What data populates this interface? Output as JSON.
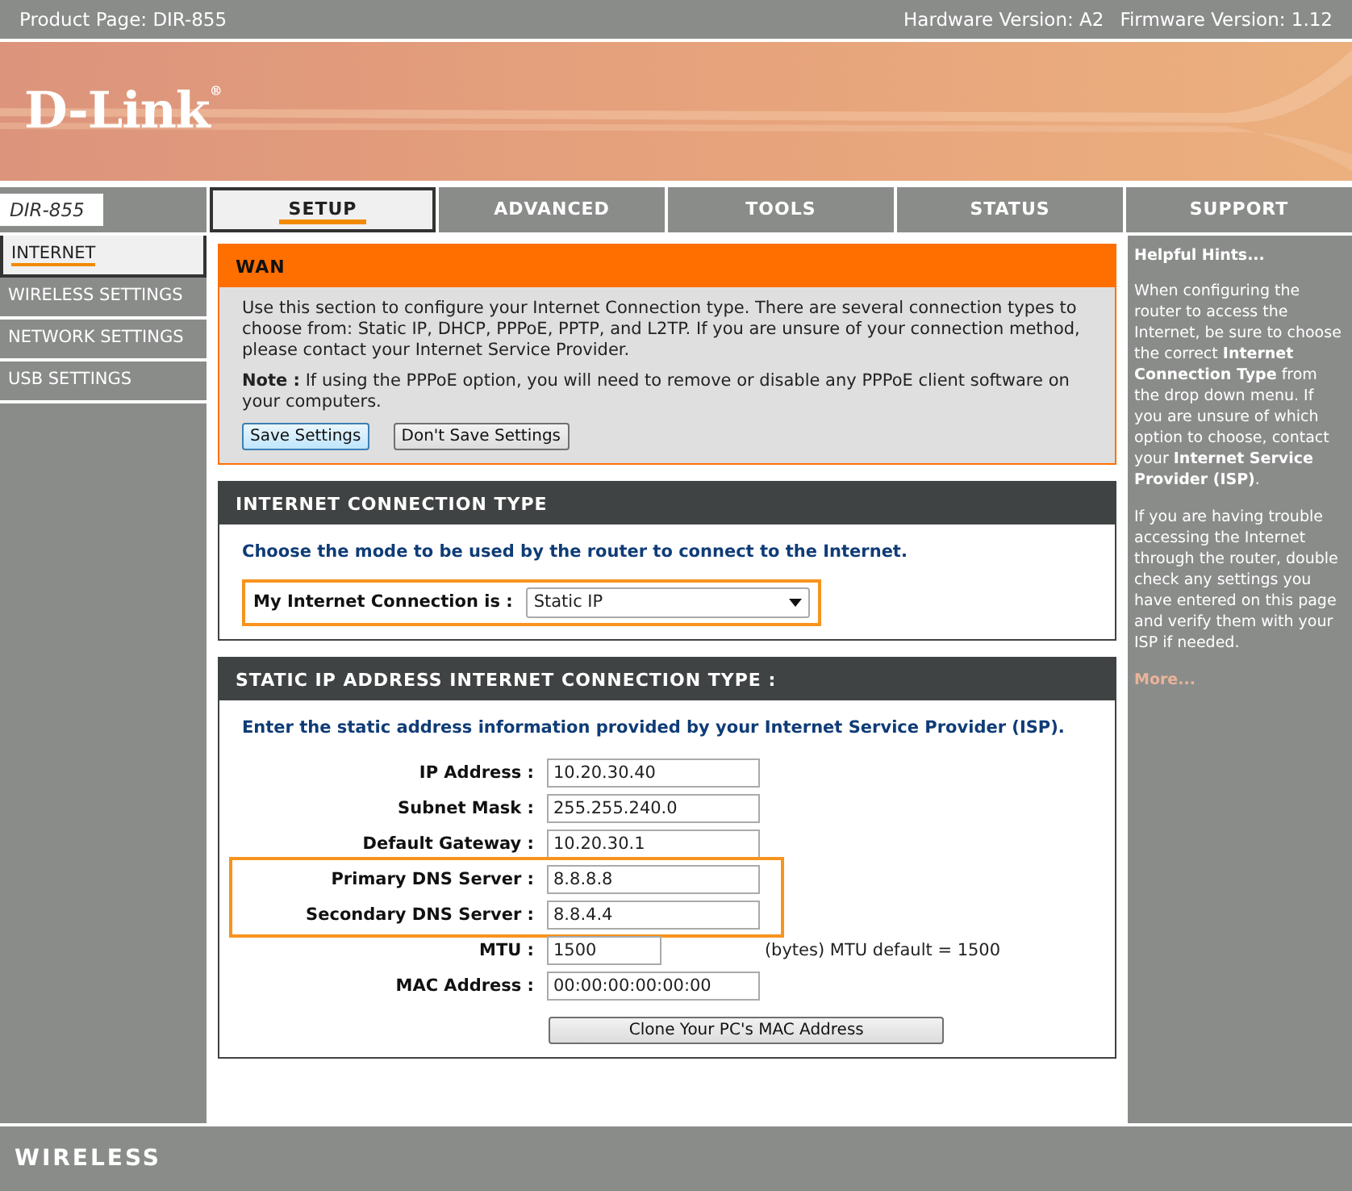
{
  "top_bar": {
    "product": "Product Page: DIR-855",
    "hardware": "Hardware Version: A2",
    "firmware": "Firmware Version: 1.12"
  },
  "banner": {
    "logo": "D-Link$^{®}$"
  },
  "model_badge": "DIR-855",
  "tabs": [
    {
      "label": "SETUP",
      "selected": true
    },
    {
      "label": "ADVANCED",
      "selected": false
    },
    {
      "label": "TOOLS",
      "selected": false
    },
    {
      "label": "STATUS",
      "selected": false
    },
    {
      "label": "SUPPORT",
      "selected": false
    }
  ],
  "sidebar": {
    "items": [
      {
        "label": "INTERNET",
        "selected": true
      },
      {
        "label": "WIRELESS SETTINGS",
        "selected": false
      },
      {
        "label": "NETWORK SETTINGS",
        "selected": false
      },
      {
        "label": "USB SETTINGS",
        "selected": false
      }
    ]
  },
  "wan": {
    "title": "WAN",
    "intro": "Use this section to configure your Internet Connection type. There are several connection types to choose from: Static IP, DHCP, PPPoE, PPTP, and L2TP. If you are unsure of your connection method, please contact your Internet Service Provider.",
    "note": "**Note :** If using the PPPoE option, you will need to remove or disable any PPPoE client software on your computers.",
    "buttons": [
      {
        "label": "Save Settings",
        "focused": true
      },
      {
        "label": "Don't Save Settings",
        "focused": false
      }
    ]
  },
  "connection_type": {
    "title": "INTERNET CONNECTION TYPE",
    "prompt": "Choose the mode to be used by the router to connect to the Internet.",
    "label": "My Internet Connection is :",
    "value": "Static IP",
    "highlighted": true
  },
  "static_ip": {
    "title": "STATIC IP ADDRESS INTERNET CONNECTION TYPE :",
    "prompt": "Enter the static address information provided by your Internet Service Provider (ISP).",
    "fields": [
      {
        "label": "IP Address :",
        "value": "10.20.30.40",
        "kind": "wide",
        "highlighted": false
      },
      {
        "label": "Subnet Mask :",
        "value": "255.255.240.0",
        "kind": "wide",
        "highlighted": false
      },
      {
        "label": "Default Gateway :",
        "value": "10.20.30.1",
        "kind": "wide",
        "highlighted": false
      },
      {
        "label": "Primary DNS Server :",
        "value": "8.8.8.8",
        "kind": "wide",
        "highlighted": true
      },
      {
        "label": "Secondary DNS Server :",
        "value": "8.8.4.4",
        "kind": "wide",
        "highlighted": true
      },
      {
        "label": "MTU :",
        "value": "1500",
        "kind": "narrow",
        "suffix": "(bytes) MTU default = 1500",
        "highlighted": false
      },
      {
        "label": "MAC Address :",
        "value": "00:00:00:00:00:00",
        "kind": "wide",
        "highlighted": false
      }
    ],
    "clone_button": "Clone Your PC's MAC Address"
  },
  "hints": {
    "title": "Helpful Hints...",
    "paragraphs": [
      "When configuring the router to access the Internet, be sure to choose the correct **Internet Connection Type** from the drop down menu. If you are unsure of which option to choose, contact your **Internet Service Provider (ISP)**.",
      "If you are having trouble accessing the Internet through the router, double check any settings you have entered on this page and verify them with your ISP if needed."
    ],
    "more": "More..."
  },
  "footer": {
    "brand": "WIRELESS"
  }
}
